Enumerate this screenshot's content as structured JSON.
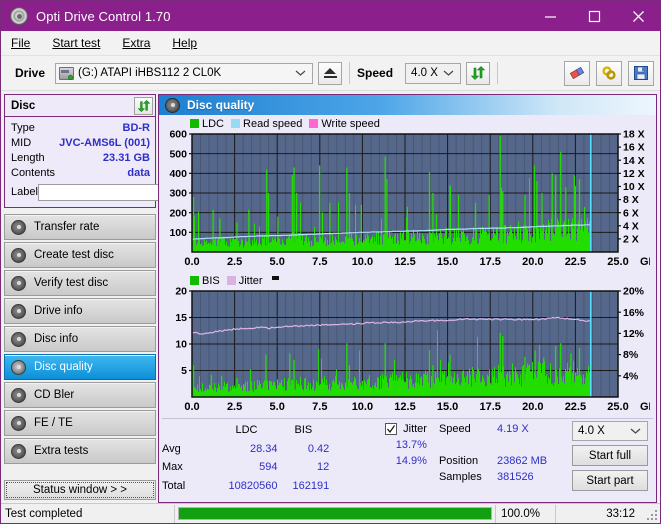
{
  "window": {
    "title": "Opti Drive Control 1.70",
    "icon": "disc-icon",
    "minimize": "–",
    "maximize": "□",
    "close": "✕"
  },
  "menu": [
    {
      "label": "File",
      "accel": "F"
    },
    {
      "label": "Start test",
      "accel": "S"
    },
    {
      "label": "Extra",
      "accel": "x"
    },
    {
      "label": "Help",
      "accel": "H"
    }
  ],
  "toolbar": {
    "drive_label": "Drive",
    "drive_value": "(G:)  ATAPI iHBS112  2 CL0K",
    "eject_icon": "eject-icon",
    "speed_label": "Speed",
    "speed_value": "4.0 X",
    "refresh_icon": "refresh-icon",
    "erase_icon": "eraser-icon",
    "bitsetting_icon": "bitsetting-icon",
    "save_icon": "save-icon"
  },
  "disc": {
    "header": "Disc",
    "refresh_icon": "refresh-icon",
    "rows": [
      {
        "key": "Type",
        "value": "BD-R"
      },
      {
        "key": "MID",
        "value": "JVC-AMS6L (001)"
      },
      {
        "key": "Length",
        "value": "23.31 GB"
      },
      {
        "key": "Contents",
        "value": "data"
      }
    ],
    "label_key": "Label",
    "label_value": "",
    "label_placeholder": "",
    "disc_button_icon": "disc-icon"
  },
  "nav": {
    "items": [
      {
        "label": "Transfer rate",
        "icon": "disc-icon",
        "active": false
      },
      {
        "label": "Create test disc",
        "icon": "disc-icon",
        "active": false
      },
      {
        "label": "Verify test disc",
        "icon": "disc-icon",
        "active": false
      },
      {
        "label": "Drive info",
        "icon": "disc-icon",
        "active": false
      },
      {
        "label": "Disc info",
        "icon": "disc-icon",
        "active": false
      },
      {
        "label": "Disc quality",
        "icon": "disc-icon",
        "active": true
      },
      {
        "label": "CD Bler",
        "icon": "disc-icon",
        "active": false
      },
      {
        "label": "FE / TE",
        "icon": "disc-icon",
        "active": false
      },
      {
        "label": "Extra tests",
        "icon": "disc-icon",
        "active": false
      }
    ],
    "status_window_button": "Status window > >"
  },
  "panel": {
    "title": "Disc quality",
    "icon": "disc-icon"
  },
  "colors": {
    "title_bar": "#8b1f8b",
    "panel_border": "#7a2a7a",
    "plot_bg": "#55678b",
    "ldc_green": "#22dd00",
    "read_speed": "#9ad9f5",
    "write_speed": "#ff66d0",
    "jitter_pink": "#d9b3e0",
    "accent_blue": "#2f2fc8",
    "progress_green": "#12a012",
    "active_nav": "#0d8fd8"
  },
  "chart_data": [
    {
      "type": "area",
      "name": "ldc-chart",
      "title": "",
      "xlabel": "GB",
      "ylabel": "",
      "xlim": [
        0,
        25
      ],
      "ylim": [
        0,
        600
      ],
      "y2lim": [
        0,
        18
      ],
      "y2label": "X",
      "xticks": [
        "0.0",
        "2.5",
        "5.0",
        "7.5",
        "10.0",
        "12.5",
        "15.0",
        "17.5",
        "20.0",
        "22.5",
        "25.0"
      ],
      "yticks": [
        "100",
        "200",
        "300",
        "400",
        "500",
        "600"
      ],
      "y2ticks": [
        "2 X",
        "4 X",
        "6 X",
        "8 X",
        "10 X",
        "12 X",
        "14 X",
        "16 X",
        "18 X"
      ],
      "grid": true,
      "legend": [
        {
          "label": "LDC",
          "color": "#11bb00"
        },
        {
          "label": "Read speed",
          "color": "#9ad9f5"
        },
        {
          "label": "Write speed",
          "color": "#ff66d0"
        }
      ],
      "data_end_gb": 23.4,
      "series": [
        {
          "name": "LDC",
          "type": "bar",
          "color": "#22dd00",
          "envelope_base": [
            60,
            40,
            55,
            45,
            60,
            50,
            70,
            55,
            60,
            70,
            65,
            75,
            70,
            80,
            75,
            85,
            80,
            95,
            90,
            105,
            100,
            115,
            120,
            130
          ],
          "peaks": [
            {
              "x": 0.05,
              "y": 280
            },
            {
              "x": 1.2,
              "y": 215
            },
            {
              "x": 1.6,
              "y": 170
            },
            {
              "x": 2.6,
              "y": 150
            },
            {
              "x": 3.3,
              "y": 215
            },
            {
              "x": 4.35,
              "y": 420
            },
            {
              "x": 4.45,
              "y": 300
            },
            {
              "x": 5.0,
              "y": 180
            },
            {
              "x": 5.85,
              "y": 390
            },
            {
              "x": 5.95,
              "y": 430
            },
            {
              "x": 6.1,
              "y": 300
            },
            {
              "x": 7.45,
              "y": 440
            },
            {
              "x": 8.05,
              "y": 250
            },
            {
              "x": 9.05,
              "y": 430
            },
            {
              "x": 9.2,
              "y": 300
            },
            {
              "x": 9.9,
              "y": 240
            },
            {
              "x": 11.3,
              "y": 485
            },
            {
              "x": 11.4,
              "y": 370
            },
            {
              "x": 12.6,
              "y": 230
            },
            {
              "x": 13.9,
              "y": 405
            },
            {
              "x": 14.1,
              "y": 300
            },
            {
              "x": 15.1,
              "y": 340
            },
            {
              "x": 16.6,
              "y": 250
            },
            {
              "x": 17.4,
              "y": 290
            },
            {
              "x": 18.05,
              "y": 590
            },
            {
              "x": 18.2,
              "y": 310
            },
            {
              "x": 19.5,
              "y": 290
            },
            {
              "x": 20.05,
              "y": 440
            },
            {
              "x": 20.2,
              "y": 360
            },
            {
              "x": 20.5,
              "y": 300
            },
            {
              "x": 21.1,
              "y": 400
            },
            {
              "x": 21.3,
              "y": 390
            },
            {
              "x": 21.6,
              "y": 510
            },
            {
              "x": 21.9,
              "y": 330
            },
            {
              "x": 22.4,
              "y": 390
            },
            {
              "x": 22.7,
              "y": 370
            },
            {
              "x": 23.0,
              "y": 230
            }
          ]
        },
        {
          "name": "Read speed",
          "type": "line",
          "color": "#a8e2f8",
          "axis": "y2",
          "points_x": [
            0.0,
            1.0,
            2.0,
            3.0,
            4.0,
            5.0,
            6.0,
            7.0,
            8.0,
            9.0,
            10.0,
            11.0,
            12.0,
            13.0,
            14.0,
            15.0,
            16.0,
            17.0,
            18.0,
            19.0,
            20.0,
            21.0,
            22.0,
            23.3
          ],
          "points_y": [
            1.95,
            2.1,
            2.2,
            2.35,
            2.45,
            2.5,
            2.6,
            2.7,
            2.8,
            2.9,
            3.0,
            3.05,
            3.15,
            3.2,
            3.3,
            3.45,
            3.5,
            3.6,
            3.65,
            3.7,
            3.85,
            3.95,
            4.05,
            4.15
          ]
        },
        {
          "name": "Write speed",
          "type": "line",
          "color": "#ff66d0",
          "axis": "y2",
          "points_x": [],
          "points_y": []
        }
      ],
      "marker_line_gb": 23.4,
      "marker_color": "#55ddff"
    },
    {
      "type": "area",
      "name": "bis-chart",
      "title": "",
      "xlabel": "GB",
      "ylabel": "",
      "xlim": [
        0,
        25
      ],
      "ylim": [
        0,
        20
      ],
      "y2lim": [
        0,
        20
      ],
      "y2label": "%",
      "xticks": [
        "0.0",
        "2.5",
        "5.0",
        "7.5",
        "10.0",
        "12.5",
        "15.0",
        "17.5",
        "20.0",
        "22.5",
        "25.0"
      ],
      "yticks": [
        "5",
        "10",
        "15",
        "20"
      ],
      "y2ticks": [
        "4%",
        "8%",
        "12%",
        "16%",
        "20%"
      ],
      "grid": true,
      "legend": [
        {
          "label": "BIS",
          "color": "#11bb00"
        },
        {
          "label": "Jitter",
          "color": "#d9b3e0"
        }
      ],
      "data_end_gb": 23.4,
      "series": [
        {
          "name": "BIS",
          "type": "bar",
          "color": "#22dd00",
          "envelope_base": [
            2.2,
            1.8,
            2.0,
            1.9,
            2.2,
            2.4,
            2.6,
            2.5,
            2.7,
            2.8,
            2.9,
            3.0,
            3.1,
            3.2,
            3.4,
            3.6,
            3.8,
            3.9,
            4.1,
            4.3,
            4.4,
            4.6,
            4.7,
            4.8
          ],
          "peaks": [
            {
              "x": 0.05,
              "y": 6.0
            },
            {
              "x": 1.1,
              "y": 4.2
            },
            {
              "x": 1.7,
              "y": 4.0
            },
            {
              "x": 2.6,
              "y": 3.6
            },
            {
              "x": 3.4,
              "y": 5.2
            },
            {
              "x": 4.3,
              "y": 8.0
            },
            {
              "x": 5.7,
              "y": 8.2
            },
            {
              "x": 5.95,
              "y": 7.0
            },
            {
              "x": 7.4,
              "y": 9.0
            },
            {
              "x": 9.05,
              "y": 10.1
            },
            {
              "x": 9.2,
              "y": 6.0
            },
            {
              "x": 11.3,
              "y": 10.1
            },
            {
              "x": 13.9,
              "y": 8.8
            },
            {
              "x": 14.1,
              "y": 6.0
            },
            {
              "x": 15.1,
              "y": 8.0
            },
            {
              "x": 18.05,
              "y": 12.1
            },
            {
              "x": 18.2,
              "y": 11.5
            },
            {
              "x": 19.5,
              "y": 7.6
            },
            {
              "x": 20.1,
              "y": 8.8
            },
            {
              "x": 20.6,
              "y": 7.4
            },
            {
              "x": 21.3,
              "y": 9.6
            },
            {
              "x": 21.6,
              "y": 10.1
            },
            {
              "x": 22.2,
              "y": 8.2
            },
            {
              "x": 22.7,
              "y": 9.2
            }
          ]
        },
        {
          "name": "Jitter",
          "type": "line",
          "color": "#dcb5e4",
          "axis": "y2",
          "points_x": [
            0.0,
            0.5,
            1.0,
            1.5,
            2.0,
            2.5,
            3.0,
            3.5,
            4.0,
            4.5,
            5.0,
            5.5,
            6.0,
            6.5,
            7.0,
            7.5,
            8.0,
            8.5,
            9.0,
            9.5,
            10.0,
            10.5,
            11.0,
            11.5,
            12.0,
            12.5,
            13.0,
            13.5,
            14.0,
            14.5,
            15.0,
            15.5,
            16.0,
            16.5,
            17.0,
            17.5,
            18.0,
            18.5,
            19.0,
            19.5,
            20.0,
            20.5,
            21.0,
            21.5,
            22.0,
            22.5,
            23.3
          ],
          "points_y": [
            12.2,
            11.9,
            12.1,
            12.4,
            12.6,
            12.8,
            12.9,
            13.0,
            13.1,
            13.0,
            13.2,
            13.3,
            13.4,
            13.4,
            13.5,
            13.6,
            13.6,
            13.7,
            13.8,
            13.8,
            13.9,
            14.0,
            14.0,
            14.1,
            14.1,
            14.2,
            14.3,
            14.3,
            14.4,
            14.4,
            14.5,
            14.6,
            14.7,
            14.7,
            14.6,
            14.7,
            14.6,
            14.7,
            14.6,
            14.6,
            14.7,
            14.6,
            14.8,
            15.0,
            14.8,
            14.7,
            14.3
          ]
        }
      ],
      "marker_line_gb": 23.4,
      "marker_color": "#55ddff"
    }
  ],
  "stats": {
    "col_headers": [
      "LDC",
      "BIS"
    ],
    "rows": [
      {
        "label": "Avg",
        "ldc": "28.34",
        "bis": "0.42",
        "jitter": "13.7%"
      },
      {
        "label": "Max",
        "ldc": "594",
        "bis": "12",
        "jitter": "14.9%"
      },
      {
        "label": "Total",
        "ldc": "10820560",
        "bis": "162191",
        "jitter": ""
      }
    ],
    "jitter_label": "Jitter",
    "jitter_checked": true,
    "speed_label": "Speed",
    "speed_value": "4.19 X",
    "position_label": "Position",
    "position_value": "23862 MB",
    "samples_label": "Samples",
    "samples_value": "381526",
    "speed_select": "4.0 X",
    "start_full_button": "Start full",
    "start_part_button": "Start part"
  },
  "statusbar": {
    "message": "Test completed",
    "progress_percent": 100.0,
    "progress_text": "100.0%",
    "elapsed": "33:12"
  }
}
